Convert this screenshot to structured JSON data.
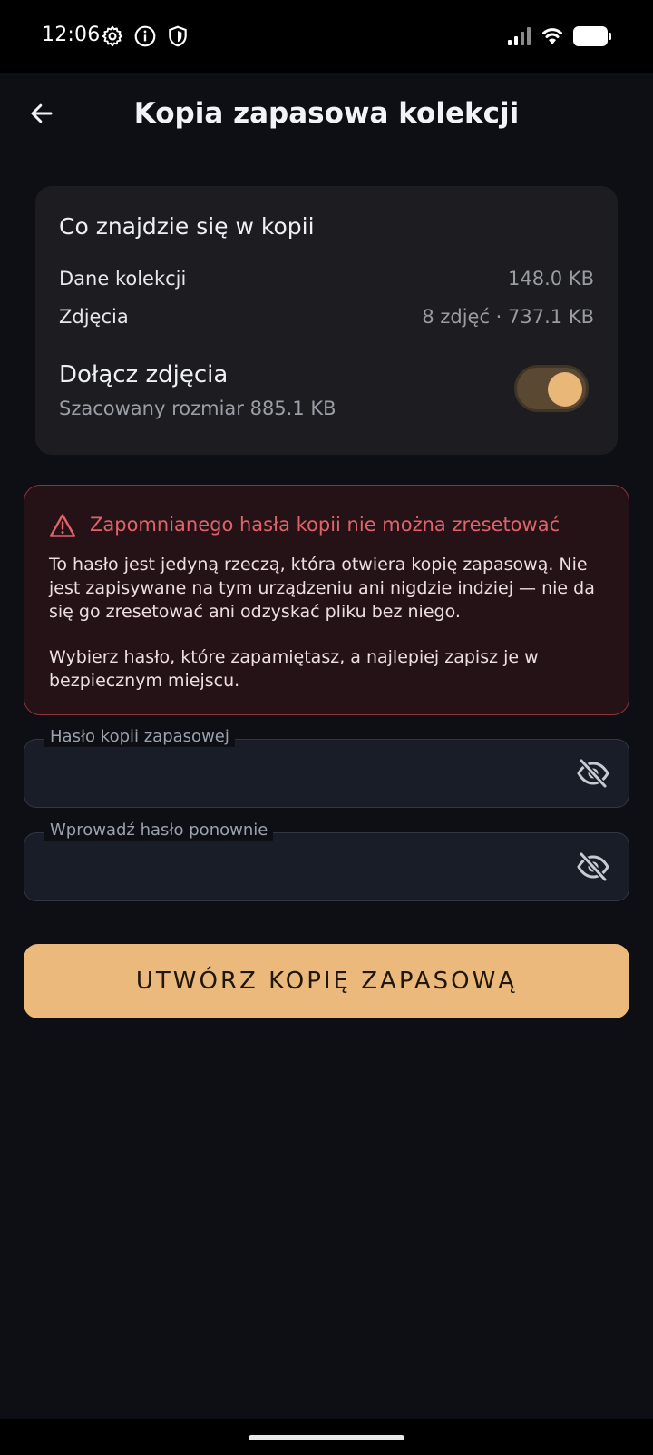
{
  "status": {
    "time": "12:06"
  },
  "header": {
    "title": "Kopia zapasowa kolekcji"
  },
  "summary": {
    "title": "Co znajdzie się w kopii",
    "rows": [
      {
        "label": "Dane kolekcji",
        "value": "148.0 KB"
      },
      {
        "label": "Zdjęcia",
        "value": "8 zdjęć · 737.1 KB"
      }
    ],
    "toggle_title": "Dołącz zdjęcia",
    "toggle_subtitle": "Szacowany rozmiar 885.1 KB",
    "toggle_on": true
  },
  "warning": {
    "title": "Zapomnianego hasła kopii nie można zresetować",
    "body1": "To hasło jest jedyną rzeczą, która otwiera kopię zapasową. Nie jest zapisywane na tym urządzeniu ani nigdzie indziej — nie da się go zresetować ani odzyskać pliku bez niego.",
    "body2": "Wybierz hasło, które zapamiętasz, a najlepiej zapisz je w bezpiecznym miejscu."
  },
  "form": {
    "password_label": "Hasło kopii zapasowej",
    "password_value": "",
    "confirm_label": "Wprowadź hasło ponownie",
    "confirm_value": ""
  },
  "actions": {
    "create_label": "UTWÓRZ KOPIĘ ZAPASOWĄ"
  },
  "colors": {
    "accent": "#EBB97B",
    "background": "#0D0F14",
    "warning": "#E0636A",
    "card": "#1C1C21"
  },
  "icons": {
    "back": "arrow-left-icon",
    "settings": "gear-icon",
    "info": "info-icon",
    "shield": "shield-icon",
    "signal": "signal-icon",
    "wifi": "wifi-icon",
    "battery": "battery-icon",
    "warning": "warning-triangle-icon",
    "visibility": "eye-off-icon"
  }
}
